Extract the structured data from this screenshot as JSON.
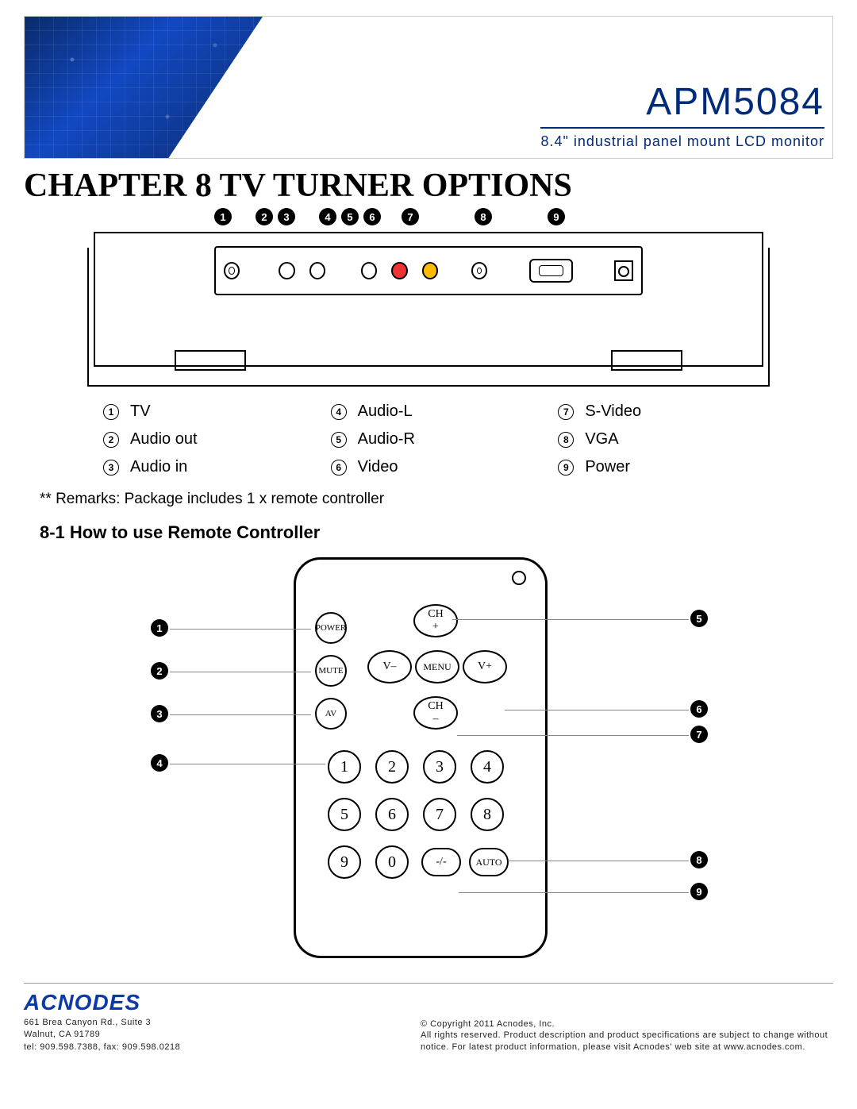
{
  "header": {
    "model": "APM5084",
    "subtitle": "8.4\" industrial panel mount LCD monitor"
  },
  "chapter_title": "CHAPTER 8 TV TURNER OPTIONS",
  "top_callouts": [
    "1",
    "2",
    "3",
    "4",
    "5",
    "6",
    "7",
    "8",
    "9"
  ],
  "ports": [
    {
      "n": "1",
      "label": "TV"
    },
    {
      "n": "2",
      "label": "Audio out"
    },
    {
      "n": "3",
      "label": "Audio in"
    },
    {
      "n": "4",
      "label": "Audio-L"
    },
    {
      "n": "5",
      "label": "Audio-R"
    },
    {
      "n": "6",
      "label": "Video"
    },
    {
      "n": "7",
      "label": "S-Video"
    },
    {
      "n": "8",
      "label": "VGA"
    },
    {
      "n": "9",
      "label": "Power"
    }
  ],
  "remarks": "** Remarks: Package includes 1 x remote controller",
  "section_8_1": "8-1  How to use Remote Controller",
  "remote": {
    "left_callouts": [
      "1",
      "2",
      "3",
      "4"
    ],
    "right_callouts": [
      "5",
      "6",
      "7",
      "8",
      "9"
    ],
    "buttons": {
      "power": "POWER",
      "mute": "MUTE",
      "av": "AV",
      "ch_up": "CH\n+",
      "ch_dn": "CH\n–",
      "v_minus": "V–",
      "v_plus": "V+",
      "menu": "MENU",
      "nums": [
        "1",
        "2",
        "3",
        "4",
        "5",
        "6",
        "7",
        "8",
        "9",
        "0"
      ],
      "dash": "-/-",
      "auto": "AUTO"
    }
  },
  "footer": {
    "brand": "ACNODES",
    "addr_line1": "661 Brea Canyon Rd., Suite 3",
    "addr_line2": "Walnut, CA 91789",
    "addr_line3": "tel: 909.598.7388, fax: 909.598.0218",
    "copyright": "© Copyright 2011 Acnodes, Inc.",
    "legal": "All rights reserved. Product description and product specifications are subject to change without notice. For latest product information, please visit Acnodes' web site at www.acnodes.com."
  }
}
